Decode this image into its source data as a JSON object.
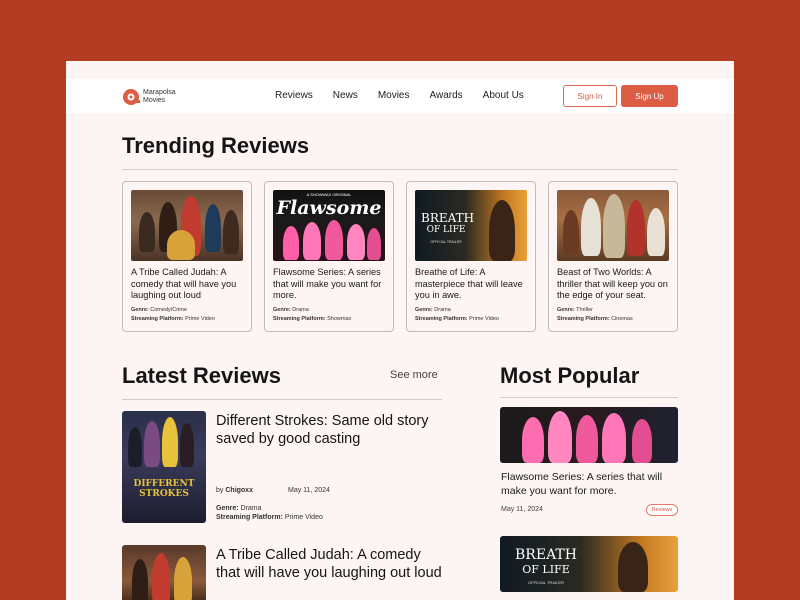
{
  "brand": {
    "name_line1": "Marapolsa",
    "name_line2": "Movies",
    "accent": "#dd5c44",
    "background": "#b23c22"
  },
  "nav": {
    "items": [
      "Reviews",
      "News",
      "Movies",
      "Awards",
      "About Us"
    ],
    "sign_in": "Sign In",
    "sign_up": "Sign Up"
  },
  "trending": {
    "title": "Trending Reviews",
    "cards": [
      {
        "title": "A Tribe Called Judah: A comedy that will have you laughing out loud",
        "genre_label": "Genre:",
        "genre": "Comedy/Crime",
        "platform_label": "Streaming Platform:",
        "platform": "Prime Video",
        "thumb_text": ""
      },
      {
        "title": "Flawsome Series: A series that will make you want for more.",
        "genre_label": "Genre:",
        "genre": "Drama",
        "platform_label": "Streaming Platform:",
        "platform": "Showmax",
        "thumb_text": "Flawsome",
        "thumb_sub": "A SHOWMAX ORIGINAL"
      },
      {
        "title": "Breathe of Life: A masterpiece that will leave you in awe.",
        "genre_label": "Genre:",
        "genre": "Drama",
        "platform_label": "Streaming Platform:",
        "platform": "Prime Video",
        "thumb_text": "BREATH",
        "thumb_sub": "OF LIFE",
        "thumb_sub2": "OFFICIAL TRAILER"
      },
      {
        "title": "Beast of Two Worlds: A thriller that will keep you on the edge of your seat.",
        "genre_label": "Genre:",
        "genre": "Thriller",
        "platform_label": "Streaming Platform:",
        "platform": "Cinemas",
        "thumb_text": ""
      }
    ]
  },
  "latest": {
    "title": "Latest Reviews",
    "see_more": "See more",
    "items": [
      {
        "title": "Different Strokes: Same old story saved by good casting",
        "by_label": "by",
        "author": "Chigoxx",
        "date": "May 11, 2024",
        "genre_label": "Genre:",
        "genre": "Drama",
        "platform_label": "Streaming Platform:",
        "platform": "Prime Video",
        "poster_text": "DIFFERENT STROKES"
      },
      {
        "title": "A Tribe Called Judah: A comedy that will have you laughing out loud"
      }
    ]
  },
  "popular": {
    "title": "Most Popular",
    "items": [
      {
        "title": "Flawsome Series: A series that will make you want for more.",
        "date": "May 11, 2024",
        "badge": "Reviews"
      },
      {
        "thumb_text": "BREATH",
        "thumb_sub": "OF LIFE",
        "thumb_sub2": "OFFICIAL TRAILER"
      }
    ]
  }
}
